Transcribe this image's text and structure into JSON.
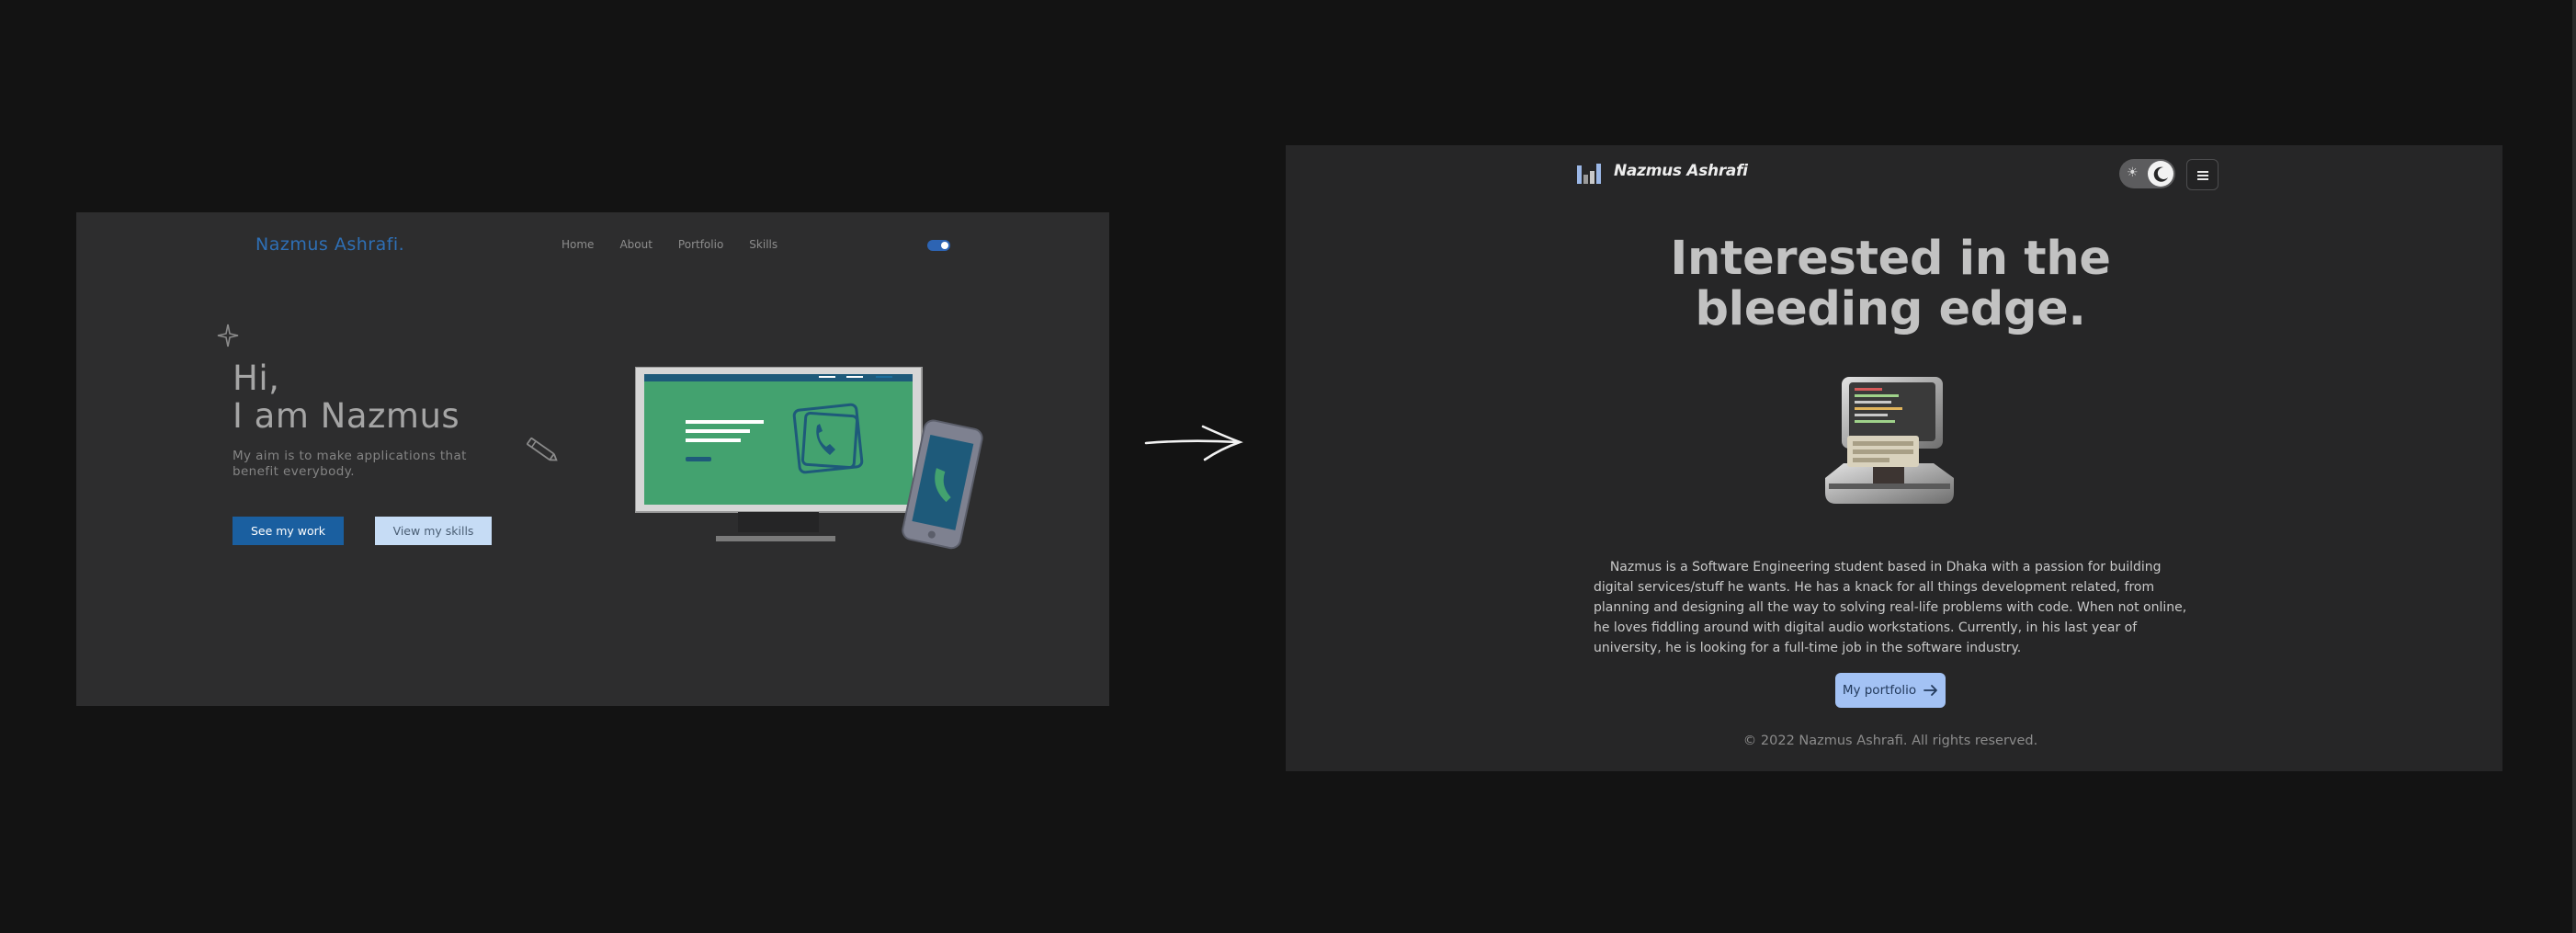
{
  "old_site": {
    "brand": "Nazmus Ashrafi.",
    "nav": [
      "Home",
      "About",
      "Portfolio",
      "Skills"
    ],
    "greeting_line1": "Hi,",
    "greeting_line2": "I am Nazmus",
    "aim": "My aim is to make applications that benefit everybody.",
    "primary_button": "See my work",
    "secondary_button": "View my skills",
    "accent_color": "#2e6fb5",
    "icons": [
      "sparkle-icon",
      "pencil-icon",
      "phone-icon",
      "theme-toggle"
    ]
  },
  "new_site": {
    "brand": "Nazmus Ashrafi",
    "headline_line1": "Interested in the",
    "headline_line2": "bleeding edge.",
    "bio": "Nazmus is a Software Engineering student based in Dhaka with a passion for building digital services/stuff he wants. He has a knack for all things development related, from planning and designing all the way to solving real-life problems with code. When not online, he loves fiddling around with digital audio workstations. Currently, in his last year of university, he is looking for a full-time job in the software industry.",
    "portfolio_button": "My portfolio",
    "footer": "© 2022 Nazmus Ashrafi. All rights reserved.",
    "accent_color": "#a3c2f4",
    "icons": [
      "bar-chart-logo-icon",
      "sun-icon",
      "moon-icon",
      "hamburger-menu-icon",
      "arrow-right-icon"
    ]
  }
}
